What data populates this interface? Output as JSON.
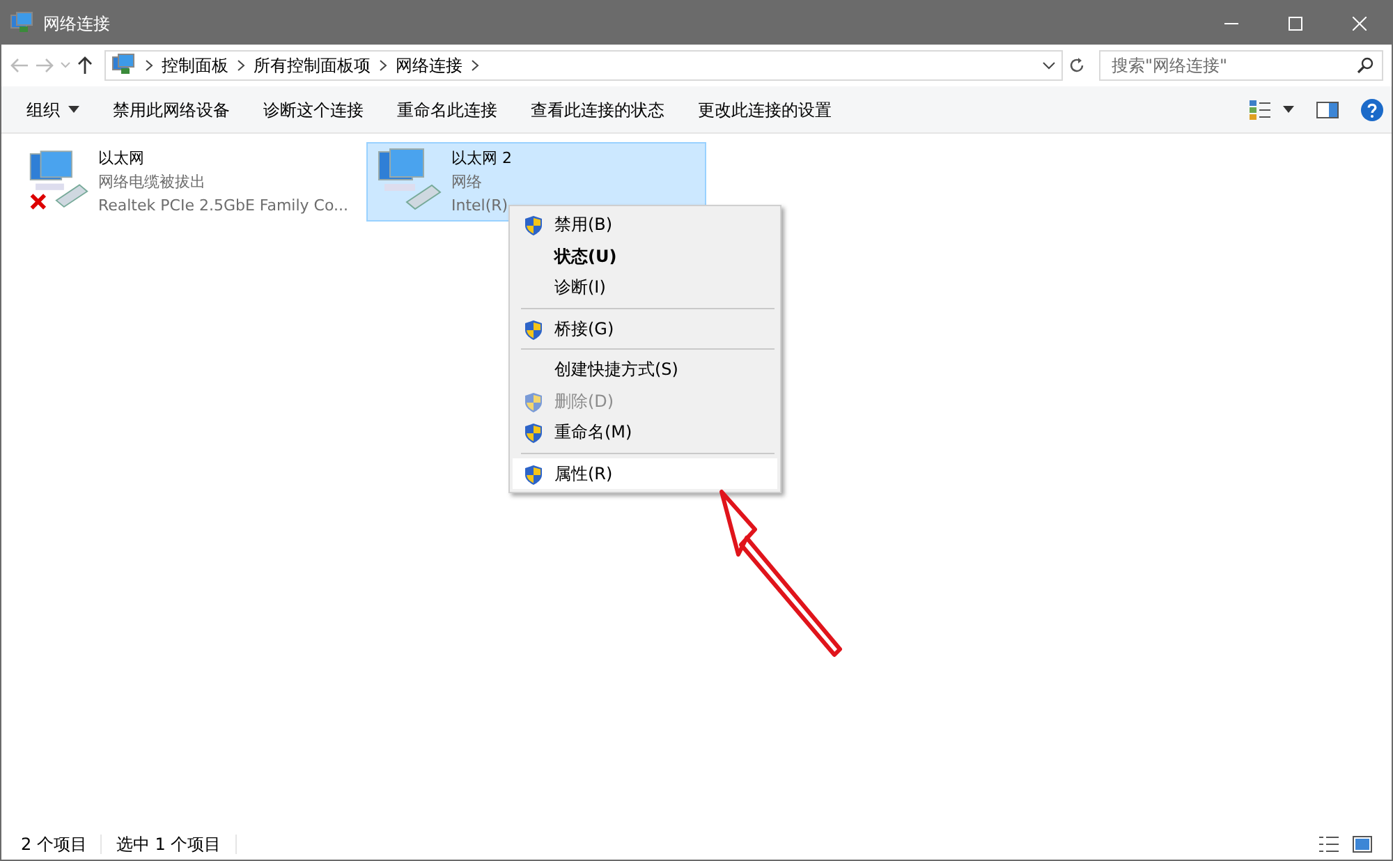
{
  "window": {
    "title": "网络连接"
  },
  "address": {
    "crumbs": [
      "控制面板",
      "所有控制面板项",
      "网络连接"
    ]
  },
  "search": {
    "placeholder": "搜索\"网络连接\""
  },
  "commands": [
    {
      "label": "组织",
      "dropdown": true
    },
    {
      "label": "禁用此网络设备",
      "dropdown": false
    },
    {
      "label": "诊断这个连接",
      "dropdown": false
    },
    {
      "label": "重命名此连接",
      "dropdown": false
    },
    {
      "label": "查看此连接的状态",
      "dropdown": false
    },
    {
      "label": "更改此连接的设置",
      "dropdown": false
    }
  ],
  "connections": [
    {
      "name": "以太网",
      "status": "网络电缆被拔出",
      "device": "Realtek PCIe 2.5GbE Family Co...",
      "disconnected": true,
      "selected": false
    },
    {
      "name": "以太网 2",
      "status": "网络",
      "device": "Intel(R)",
      "disconnected": false,
      "selected": true
    }
  ],
  "context_menu": [
    {
      "kind": "item",
      "label": "禁用(B)",
      "shield": true,
      "bold": false,
      "disabled": false,
      "selected": false
    },
    {
      "kind": "item",
      "label": "状态(U)",
      "shield": false,
      "bold": true,
      "disabled": false,
      "selected": false
    },
    {
      "kind": "item",
      "label": "诊断(I)",
      "shield": false,
      "bold": false,
      "disabled": false,
      "selected": false
    },
    {
      "kind": "separator"
    },
    {
      "kind": "item",
      "label": "桥接(G)",
      "shield": true,
      "bold": false,
      "disabled": false,
      "selected": false
    },
    {
      "kind": "separator"
    },
    {
      "kind": "item",
      "label": "创建快捷方式(S)",
      "shield": false,
      "bold": false,
      "disabled": false,
      "selected": false
    },
    {
      "kind": "item",
      "label": "删除(D)",
      "shield": true,
      "bold": false,
      "disabled": true,
      "selected": false
    },
    {
      "kind": "item",
      "label": "重命名(M)",
      "shield": true,
      "bold": false,
      "disabled": false,
      "selected": false
    },
    {
      "kind": "separator"
    },
    {
      "kind": "item",
      "label": "属性(R)",
      "shield": true,
      "bold": false,
      "disabled": false,
      "selected": true
    }
  ],
  "status_bar": {
    "count": "2 个项目",
    "selection": "选中 1 个项目"
  }
}
